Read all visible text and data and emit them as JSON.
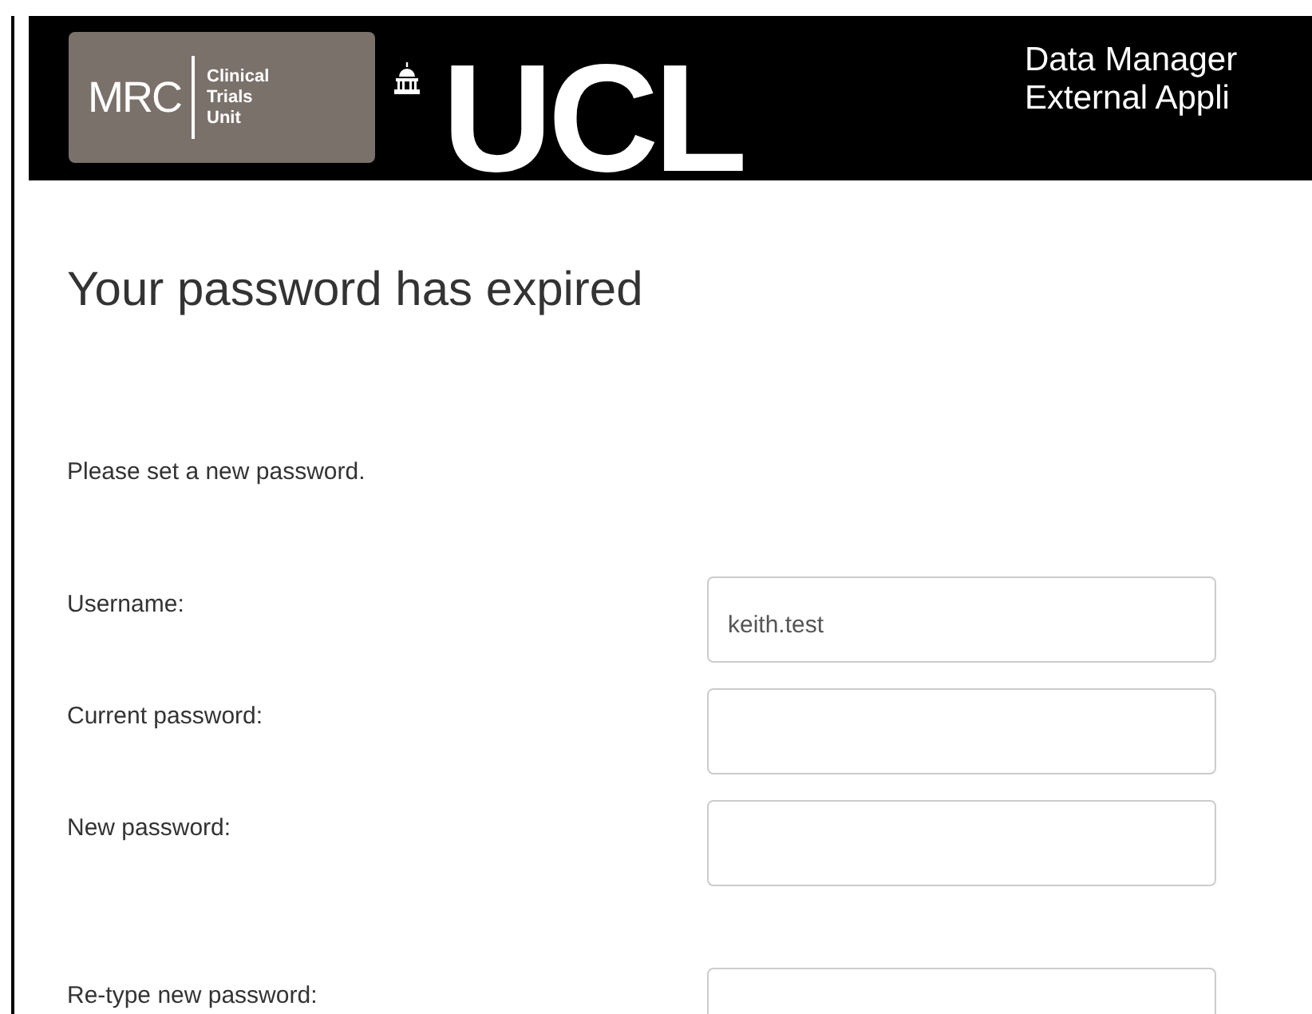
{
  "header": {
    "mrc_logo": {
      "name": "MRC",
      "lines": [
        "Clinical",
        "Trials",
        "Unit"
      ]
    },
    "ucl_logo": "UCL",
    "title_lines": [
      "Data Manager",
      "External Appli"
    ]
  },
  "heading": "Your password has expired",
  "instruction": "Please set a new password.",
  "fields": [
    {
      "label": "Username:",
      "value": "keith.test"
    },
    {
      "label": "Current password:"
    },
    {
      "label": "New password:"
    }
  ],
  "confirm_fields": [
    {
      "label": "Re-type new password:"
    }
  ]
}
